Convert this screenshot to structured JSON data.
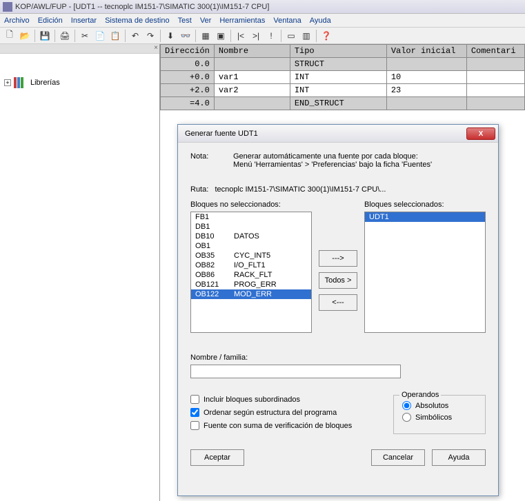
{
  "window": {
    "title": "KOP/AWL/FUP  - [UDT1 -- tecnoplc IM151-7\\SIMATIC 300(1)\\IM151-7 CPU]"
  },
  "menu": {
    "archivo": "Archivo",
    "edicion": "Edición",
    "insertar": "Insertar",
    "sistema": "Sistema de destino",
    "test": "Test",
    "ver": "Ver",
    "herramientas": "Herramientas",
    "ventana": "Ventana",
    "ayuda": "Ayuda"
  },
  "sidebar": {
    "librerias": "Librerías"
  },
  "table": {
    "headers": {
      "dir": "Dirección",
      "nombre": "Nombre",
      "tipo": "Tipo",
      "valor": "Valor inicial",
      "comentario": "Comentari"
    },
    "rows": [
      {
        "dir": "0.0",
        "nombre": "",
        "tipo": "STRUCT",
        "val": ""
      },
      {
        "dir": "+0.0",
        "nombre": "var1",
        "tipo": "INT",
        "val": "10"
      },
      {
        "dir": "+2.0",
        "nombre": "var2",
        "tipo": "INT",
        "val": "23"
      },
      {
        "dir": "=4.0",
        "nombre": "",
        "tipo": "END_STRUCT",
        "val": ""
      }
    ]
  },
  "dialog": {
    "title": "Generar fuente UDT1",
    "nota_label": "Nota:",
    "nota_text1": "Generar automáticamente una fuente por cada bloque:",
    "nota_text2": "Menú 'Herramientas' > 'Preferencias' bajo la ficha 'Fuentes'",
    "ruta_label": "Ruta:",
    "ruta_value": "tecnoplc IM151-7\\SIMATIC 300(1)\\IM151-7 CPU\\...",
    "left_label": "Bloques no seleccionados:",
    "right_label": "Bloques seleccionados:",
    "left_items": [
      {
        "c1": "FB1",
        "c2": ""
      },
      {
        "c1": "DB1",
        "c2": ""
      },
      {
        "c1": "DB10",
        "c2": "DATOS"
      },
      {
        "c1": "OB1",
        "c2": ""
      },
      {
        "c1": "OB35",
        "c2": "CYC_INT5"
      },
      {
        "c1": "OB82",
        "c2": "I/O_FLT1"
      },
      {
        "c1": "OB86",
        "c2": "RACK_FLT"
      },
      {
        "c1": "OB121",
        "c2": "PROG_ERR"
      },
      {
        "c1": "OB122",
        "c2": "MOD_ERR",
        "selected": true
      }
    ],
    "right_items": [
      {
        "c1": "UDT1",
        "selected": true
      }
    ],
    "btn_right": "--->",
    "btn_all": "Todos >",
    "btn_left": "<---",
    "nombre_label": "Nombre / familia:",
    "chk_incluir": "Incluir bloques subordinados",
    "chk_ordenar": "Ordenar según estructura del programa",
    "chk_fuente": "Fuente con suma de verificación de bloques",
    "operandos_legend": "Operandos",
    "radio_abs": "Absolutos",
    "radio_sim": "Simbólicos",
    "btn_aceptar": "Aceptar",
    "btn_cancelar": "Cancelar",
    "btn_ayuda": "Ayuda"
  }
}
